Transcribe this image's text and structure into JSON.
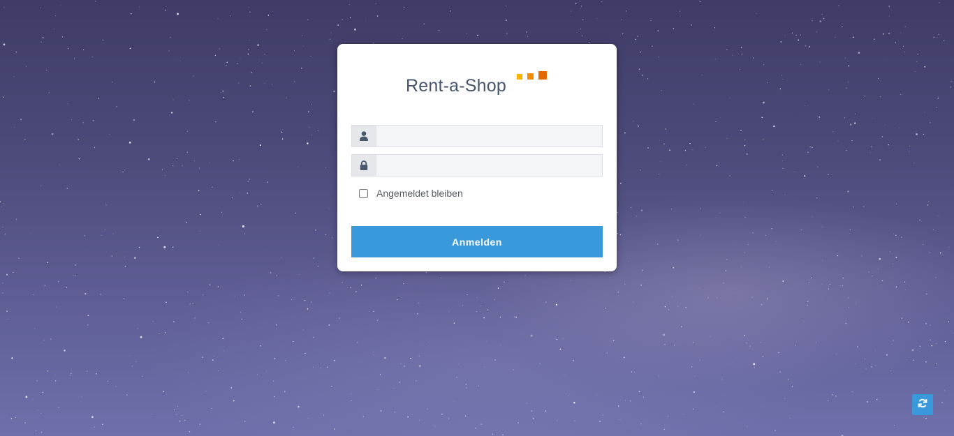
{
  "app": {
    "logo_text": "Rent-a-Shop",
    "logo_colors": [
      "#f5b400",
      "#ef8c00",
      "#e36a00"
    ]
  },
  "login": {
    "username": {
      "icon": "user-icon",
      "value": "",
      "placeholder": ""
    },
    "password": {
      "icon": "lock-icon",
      "value": "",
      "placeholder": ""
    },
    "remember_label": "Angemeldet bleiben",
    "remember_checked": false,
    "submit_label": "Anmelden"
  },
  "floating": {
    "refresh_icon": "refresh-icon"
  },
  "colors": {
    "accent": "#3a99db",
    "text": "#46556b"
  }
}
